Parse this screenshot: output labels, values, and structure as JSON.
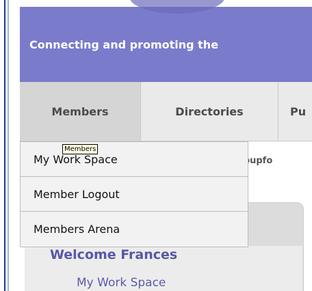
{
  "banner": {
    "tagline": "Connecting and promoting the"
  },
  "nav": {
    "tabs": [
      {
        "label": "Members"
      },
      {
        "label": "Directories"
      },
      {
        "label": "Pu"
      }
    ]
  },
  "dropdown": {
    "items": [
      {
        "label": "My Work Space"
      },
      {
        "label": "Member Logout"
      },
      {
        "label": "Members Arena"
      }
    ]
  },
  "tooltip": {
    "text": "Members"
  },
  "content": {
    "group_text": "ygroupfo",
    "welcome": "Welcome Frances",
    "workspace_link": "My Work Space"
  },
  "colors": {
    "banner": "#7b7bcb",
    "accent_text": "#5757a8",
    "nav_bg": "#eaeaea",
    "nav_active_bg": "#d5d5d5"
  }
}
